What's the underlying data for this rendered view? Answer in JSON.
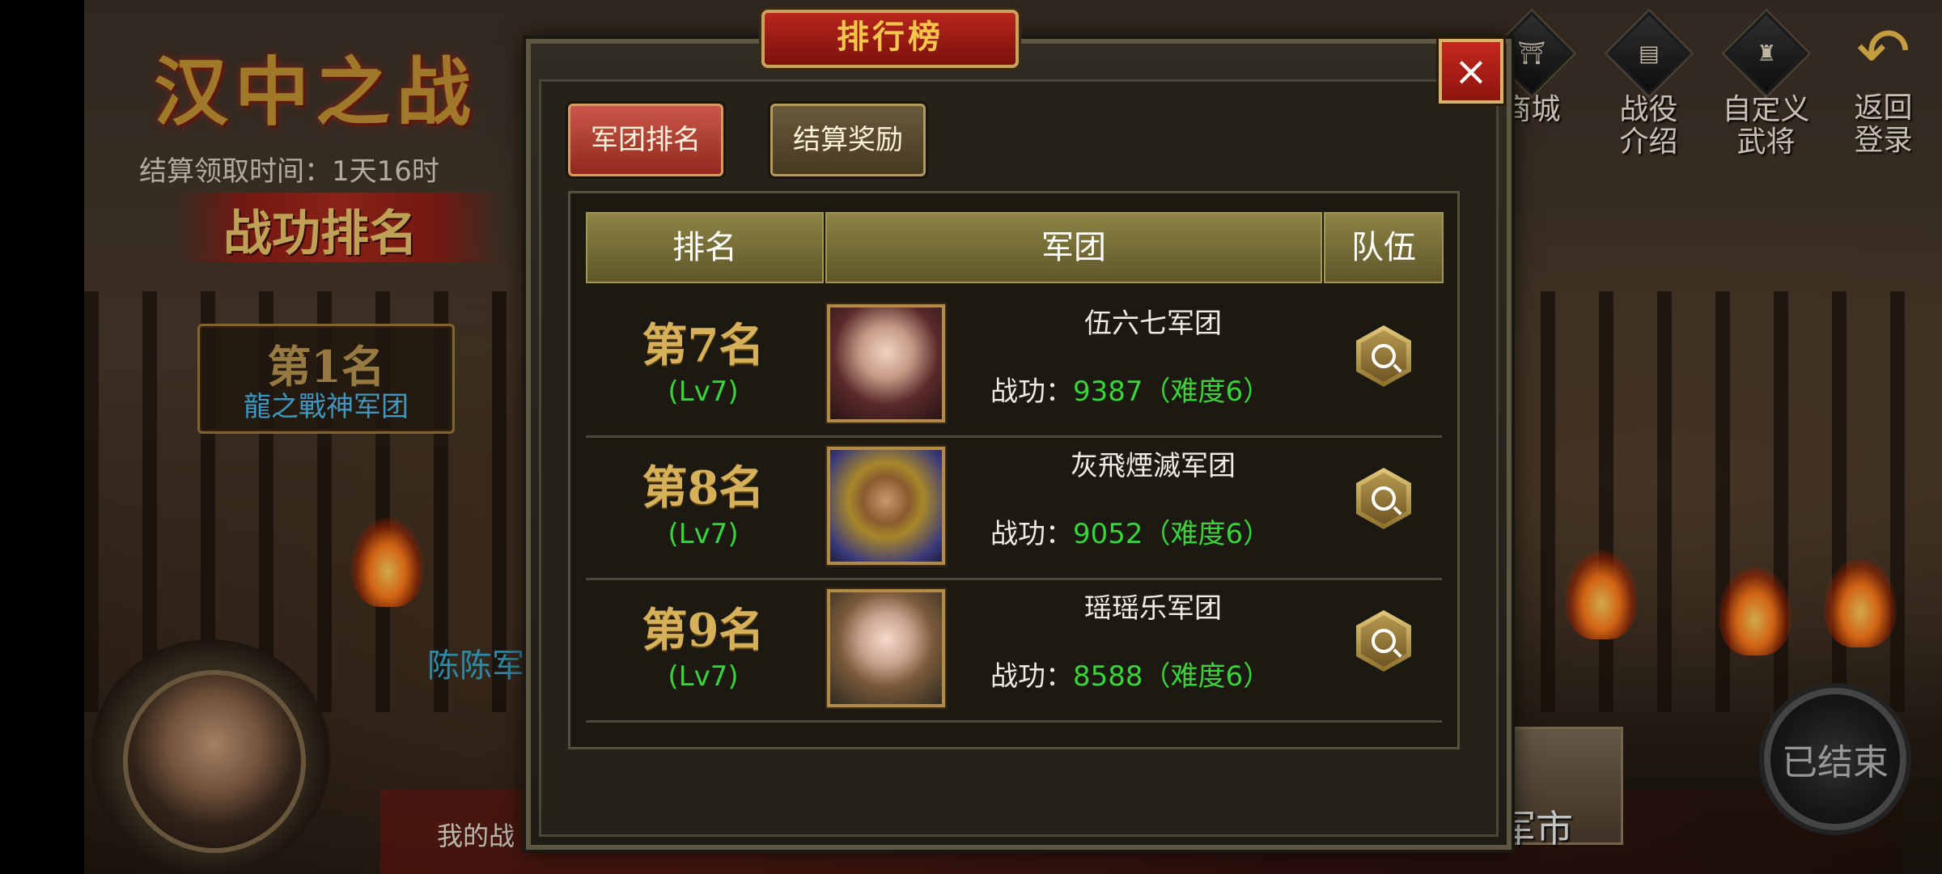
{
  "background": {
    "battle_title": "汉中之战",
    "settle_time": "结算领取时间：1天16时",
    "merit_title": "战功排名",
    "rank1": {
      "label": "第1名",
      "name": "龍之戰神军团"
    },
    "side_name": "陈陈军",
    "my_merit": "我的战",
    "ended_button": "已结束",
    "market": "军市"
  },
  "top_menu": [
    {
      "icon": "shop-icon",
      "glyph": "⛩",
      "label": "商城"
    },
    {
      "icon": "campaign-icon",
      "glyph": "▤",
      "label": "战役\n介绍"
    },
    {
      "icon": "custom-general-icon",
      "glyph": "♜",
      "label": "自定义\n武将"
    },
    {
      "icon": "back-arrow-icon",
      "glyph": "↶",
      "label": "返回\n登录"
    }
  ],
  "dialog": {
    "title": "排行榜",
    "close": "×",
    "tabs": [
      {
        "label": "军团排名",
        "active": true
      },
      {
        "label": "结算奖励",
        "active": false
      }
    ],
    "headers": {
      "rank": "排名",
      "legion": "军团",
      "team": "队伍"
    },
    "merit_prefix": "战功：",
    "rows": [
      {
        "rank": "第7名",
        "level": "(Lv7)",
        "legion": "伍六七军团",
        "merit": "9387（难度6）"
      },
      {
        "rank": "第8名",
        "level": "(Lv7)",
        "legion": "灰飛煙滅军团",
        "merit": "9052（难度6）"
      },
      {
        "rank": "第9名",
        "level": "(Lv7)",
        "legion": "瑶瑶乐军团",
        "merit": "8588（难度6）"
      }
    ]
  },
  "colors": {
    "accent_gold": "#d7b05a",
    "merit_green": "#3ad43a",
    "tab_red": "#92281e"
  }
}
